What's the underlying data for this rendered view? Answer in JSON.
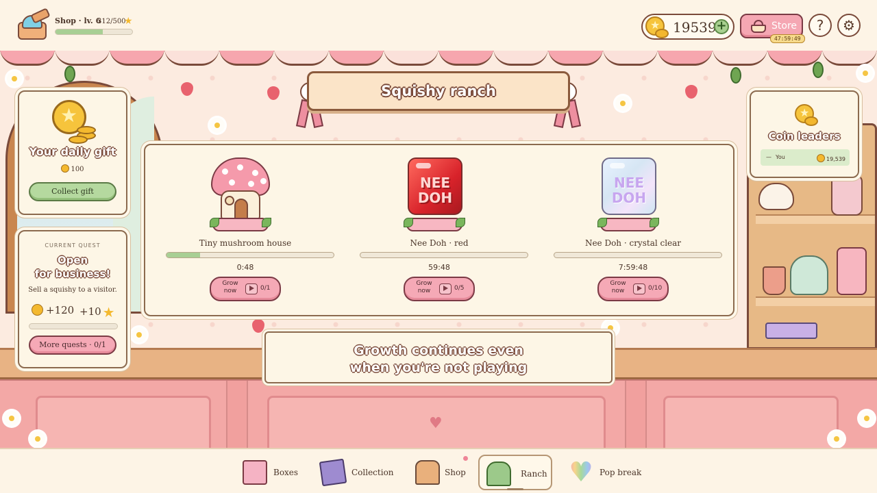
{
  "header": {
    "shop_label": "Shop · lv. 6",
    "xp_text": "312/500",
    "xp_progress": 0.62,
    "coins": "19539",
    "store_label": "Store",
    "store_timer": "47:59:49",
    "help_glyph": "?",
    "settings_glyph": "⚙"
  },
  "banner": {
    "title": "Squishy ranch"
  },
  "daily_gift": {
    "title": "Your daily gift",
    "amount": "100",
    "button": "Collect gift"
  },
  "quest": {
    "kicker": "CURRENT QUEST",
    "title_line1": "Open",
    "title_line2": "for business!",
    "description": "Sell a squishy to a visitor.",
    "reward_coins": "+120",
    "reward_stars": "+10",
    "progress": 0,
    "button": "More quests · 0/1"
  },
  "ranch_items": [
    {
      "name": "Tiny mushroom house",
      "progress": 0.2,
      "time": "0:48",
      "grow_label_1": "Grow",
      "grow_label_2": "now",
      "count": "0/1",
      "icon": "mushroom-house"
    },
    {
      "name": "Nee Doh · red",
      "progress": 0,
      "time": "59:48",
      "grow_label_1": "Grow",
      "grow_label_2": "now",
      "count": "0/5",
      "icon": "nee-doh-red",
      "cube_line1": "NEE",
      "cube_line2": "DOH"
    },
    {
      "name": "Nee Doh · crystal clear",
      "progress": 0,
      "time": "7:59:48",
      "grow_label_1": "Grow",
      "grow_label_2": "now",
      "count": "0/10",
      "icon": "nee-doh-clear",
      "cube_line1": "NEE",
      "cube_line2": "DOH"
    }
  ],
  "leaders": {
    "title": "Coin leaders",
    "rows": [
      {
        "rank": "—",
        "name": "You",
        "score": "19,539"
      }
    ]
  },
  "info": {
    "line1": "Growth continues even",
    "line2": "when you're not playing"
  },
  "nav": {
    "items": [
      {
        "label": "Boxes",
        "icon": "gift-box-icon"
      },
      {
        "label": "Collection",
        "icon": "book-icon"
      },
      {
        "label": "Shop",
        "icon": "shop-icon"
      },
      {
        "label": "Ranch",
        "icon": "greenhouse-icon"
      },
      {
        "label": "Pop break",
        "icon": "pop-it-heart-icon"
      }
    ],
    "active": "Ranch"
  },
  "colors": {
    "pink": "#f5a9b6",
    "green": "#a8cf94",
    "brown": "#7a4a3a",
    "cream": "#fdf6e6",
    "gold": "#f4b92f"
  }
}
